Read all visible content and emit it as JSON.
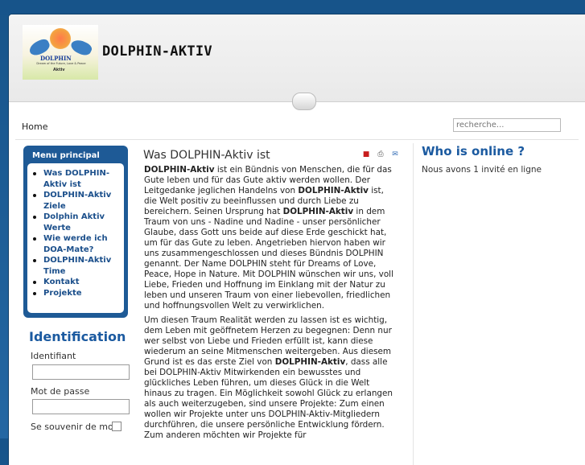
{
  "header": {
    "site_name": "DOLPHIN-AKTIV",
    "logo": {
      "word": "DOLPHIN",
      "tagline": "Dream of the Future, Love & Peace",
      "aktiv": "Aktiv"
    }
  },
  "nav": {
    "breadcrumb": "Home"
  },
  "search": {
    "placeholder": "recherche..."
  },
  "menu": {
    "title": "Menu principal",
    "items": [
      "Was DOLPHIN-Aktiv ist",
      "DOLPHIN-Aktiv Ziele",
      "Dolphin Aktiv Werte",
      "Wie werde ich DOA-Mate?",
      "DOLPHIN-Aktiv Time",
      "Kontakt",
      "Projekte"
    ]
  },
  "login": {
    "title": "Identification",
    "username_label": "Identifiant",
    "password_label": "Mot de passe",
    "remember_label": "Se souvenir de moi"
  },
  "article": {
    "title": "Was DOLPHIN-Aktiv ist",
    "p1": [
      {
        "b": true,
        "t": "DOLPHIN-Aktiv"
      },
      {
        "b": false,
        "t": " ist ein Bündnis von Menschen, die für das Gute leben und für das Gute aktiv werden wollen. Der Leitgedanke jeglichen Handelns von "
      },
      {
        "b": true,
        "t": "DOLPHIN-Aktiv"
      },
      {
        "b": false,
        "t": " ist, die Welt positiv zu beeinflussen und durch Liebe zu bereichern. Seinen Ursprung hat "
      },
      {
        "b": true,
        "t": "DOLPHIN-Aktiv"
      },
      {
        "b": false,
        "t": " in dem Traum von uns - Nadine und Nadine - unser persönlicher Glaube, dass Gott uns beide auf diese Erde geschickt hat, um für das Gute zu leben. Angetrieben hiervon haben wir uns zusammengeschlossen und dieses Bündnis DOLPHIN genannt. Der Name DOLPHIN steht für Dreams of Love, Peace, Hope in Nature. Mit DOLPHIN wünschen wir uns, voll Liebe, Frieden und Hoffnung im Einklang mit der Natur zu leben und unseren Traum von einer liebevollen, friedlichen und hoffnungsvollen Welt zu verwirklichen."
      }
    ],
    "p2": [
      {
        "b": false,
        "t": "Um diesen Traum Realität werden zu lassen ist es wichtig, dem Leben mit geöffnetem Herzen zu begegnen: Denn nur wer selbst von Liebe und Frieden erfüllt ist, kann diese wiederum an seine Mitmenschen weitergeben. Aus diesem Grund ist es das erste Ziel von "
      },
      {
        "b": true,
        "t": "DOLPHIN-Aktiv"
      },
      {
        "b": false,
        "t": ", dass alle bei DOLPHIN-Aktiv Mitwirkenden ein bewusstes und glückliches Leben führen, um dieses Glück in die Welt hinaus zu tragen. Ein Möglichkeit sowohl Glück zu erlangen als auch weiterzugeben, sind unsere Projekte: Zum einen wollen wir Projekte unter uns DOLPHIN-Aktiv-Mitgliedern durchführen, die unsere persönliche Entwicklung fördern. Zum anderen möchten wir Projekte für"
      }
    ]
  },
  "who_online": {
    "title": "Who is online ?",
    "text": "Nous avons 1 invité en ligne"
  },
  "icons": [
    "pdf-icon",
    "print-icon",
    "email-icon"
  ]
}
